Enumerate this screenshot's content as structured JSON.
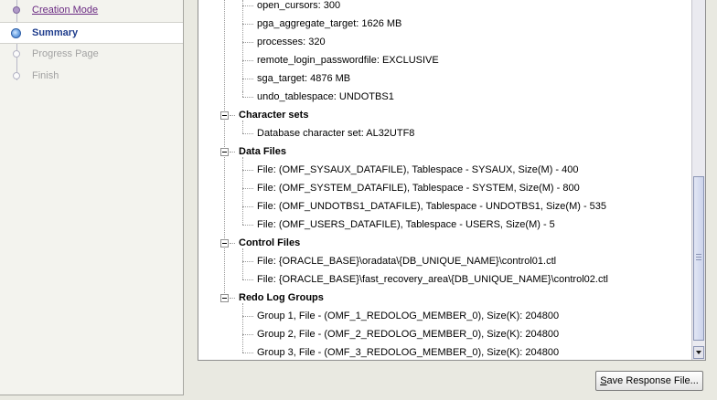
{
  "steps": [
    {
      "label": "Creation Mode",
      "state": "done"
    },
    {
      "label": "Summary",
      "state": "current"
    },
    {
      "label": "Progress Page",
      "state": "todo"
    },
    {
      "label": "Finish",
      "state": "todo"
    }
  ],
  "tree": [
    {
      "kind": "leaf",
      "text": "open_cursors: 300"
    },
    {
      "kind": "leaf",
      "text": "pga_aggregate_target: 1626 MB"
    },
    {
      "kind": "leaf",
      "text": "processes: 320"
    },
    {
      "kind": "leaf",
      "text": "remote_login_passwordfile: EXCLUSIVE"
    },
    {
      "kind": "leaf",
      "text": "sga_target: 4876 MB"
    },
    {
      "kind": "leaf",
      "text": "undo_tablespace: UNDOTBS1"
    },
    {
      "kind": "cat",
      "text": "Character sets"
    },
    {
      "kind": "leaf",
      "text": "Database character set: AL32UTF8"
    },
    {
      "kind": "cat",
      "text": "Data Files"
    },
    {
      "kind": "leaf",
      "text": "File: (OMF_SYSAUX_DATAFILE), Tablespace - SYSAUX, Size(M) - 400"
    },
    {
      "kind": "leaf",
      "text": "File: (OMF_SYSTEM_DATAFILE), Tablespace - SYSTEM, Size(M) - 800"
    },
    {
      "kind": "leaf",
      "text": "File: (OMF_UNDOTBS1_DATAFILE), Tablespace - UNDOTBS1, Size(M) - 535"
    },
    {
      "kind": "leaf",
      "text": "File: (OMF_USERS_DATAFILE), Tablespace - USERS, Size(M) - 5"
    },
    {
      "kind": "cat",
      "text": "Control Files"
    },
    {
      "kind": "leaf",
      "text": "File: {ORACLE_BASE}\\oradata\\{DB_UNIQUE_NAME}\\control01.ctl"
    },
    {
      "kind": "leaf",
      "text": "File: {ORACLE_BASE}\\fast_recovery_area\\{DB_UNIQUE_NAME}\\control02.ctl"
    },
    {
      "kind": "cat",
      "text": "Redo Log Groups"
    },
    {
      "kind": "leaf",
      "text": "Group 1, File - (OMF_1_REDOLOG_MEMBER_0), Size(K): 204800"
    },
    {
      "kind": "leaf",
      "text": "Group 2, File - (OMF_2_REDOLOG_MEMBER_0), Size(K): 204800"
    },
    {
      "kind": "leaf",
      "text": "Group 3, File - (OMF_3_REDOLOG_MEMBER_0), Size(K): 204800"
    }
  ],
  "buttons": {
    "save_response_file": {
      "mnemonic": "S",
      "rest": "ave Response File..."
    }
  },
  "icons": {
    "scroll_down": "triangle-down-icon"
  }
}
